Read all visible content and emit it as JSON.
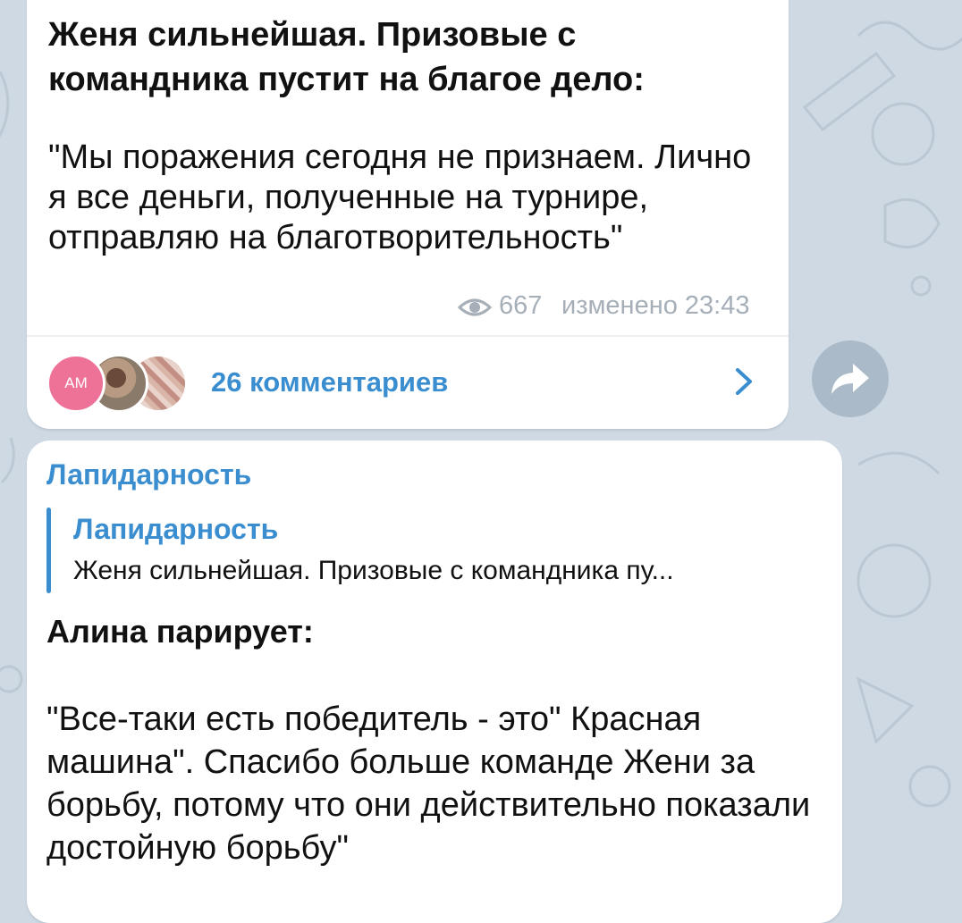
{
  "colors": {
    "background": "#cfd9e3",
    "bubble": "#ffffff",
    "accent": "#3a8ed0",
    "meta": "#a6afb8",
    "avatar_am": "#ee7198"
  },
  "post1": {
    "headline": "Женя сильнейшая. Призовые с командника пустит на благое дело:",
    "body": "\"Мы поражения сегодня не признаем. Лично я все деньги, полученные на турнире, отправляю на благотворительность\"",
    "views": "667",
    "edited": "изменено 23:43",
    "eye_icon": "eye-icon",
    "avatars": [
      {
        "initials": "AM"
      }
    ],
    "comments": "26 комментариев",
    "chevron_icon": "chevron-right-icon",
    "share_icon": "share-icon"
  },
  "post2": {
    "sender": "Лапидарность",
    "reply": {
      "name": "Лапидарность",
      "text": "Женя сильнейшая. Призовые с командника пу..."
    },
    "headline": "Алина парирует:",
    "body": "\"Все-таки есть победитель - это\" Красная машина\". Спасибо больше команде Жени за борьбу, потому что они действительно показали достойную борьбу\""
  }
}
